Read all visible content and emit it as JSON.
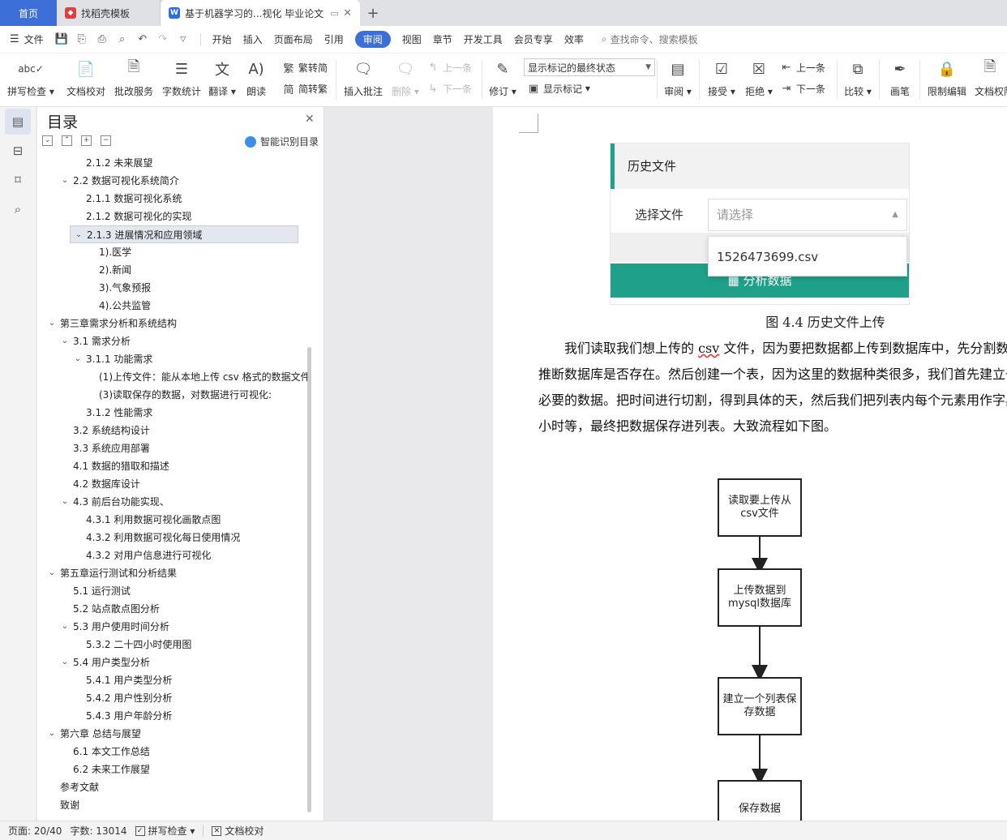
{
  "tabs": [
    {
      "label": "首页"
    },
    {
      "label": "找稻壳模板"
    },
    {
      "label": "基于机器学习的...视化 毕业论文"
    }
  ],
  "menu": {
    "file": "文件",
    "items": [
      "开始",
      "插入",
      "页面布局",
      "引用",
      "审阅",
      "视图",
      "章节",
      "开发工具",
      "会员专享",
      "效率"
    ],
    "active": "审阅",
    "search": "查找命令、搜索模板"
  },
  "ribbon": {
    "spell": "拼写检查",
    "proof": "文档校对",
    "correct": "批改服务",
    "wordcount": "字数统计",
    "translate": "翻译",
    "read": "朗读",
    "trad": "繁转简",
    "simp": "简转繁",
    "insert_comment": "插入批注",
    "delete": "删除",
    "prev": "上一条",
    "next": "下一条",
    "revise": "修订",
    "markup_state": "显示标记的最终状态",
    "show_markup": "显示标记",
    "review": "审阅",
    "accept": "接受",
    "reject": "拒绝",
    "prev2": "上一条",
    "next2": "下一条",
    "compare": "比较",
    "pen": "画笔",
    "restrict": "限制编辑",
    "doc_perm": "文档权限"
  },
  "toc": {
    "title": "目录",
    "smart": "智能识别目录",
    "items": [
      {
        "text": "2.1.2  未来展望",
        "level": 3,
        "arrow": false
      },
      {
        "text": "2.2 数据可视化系统简介",
        "level": 2,
        "arrow": true
      },
      {
        "text": "2.1.1 数据可视化系统",
        "level": 3,
        "arrow": false
      },
      {
        "text": "2.1.2  数据可视化的实现",
        "level": 3,
        "arrow": false
      },
      {
        "text": "2.1.3 进展情况和应用领域",
        "level": 3,
        "arrow": true,
        "selected": true
      },
      {
        "text": "1).医学",
        "level": 4,
        "arrow": false
      },
      {
        "text": "2).新闻",
        "level": 4,
        "arrow": false
      },
      {
        "text": "3).气象预报",
        "level": 4,
        "arrow": false
      },
      {
        "text": "4).公共监管",
        "level": 4,
        "arrow": false
      },
      {
        "text": "第三章需求分析和系统结构",
        "level": 1,
        "arrow": true
      },
      {
        "text": "3.1 需求分析",
        "level": 2,
        "arrow": true
      },
      {
        "text": "3.1.1 功能需求",
        "level": 3,
        "arrow": true
      },
      {
        "text": "(1)上传文件：能从本地上传 csv 格式的数据文件",
        "level": 4,
        "arrow": false
      },
      {
        "text": "(3)读取保存的数据，对数据进行可视化:",
        "level": 4,
        "arrow": false
      },
      {
        "text": "3.1.2 性能需求",
        "level": 3,
        "arrow": false
      },
      {
        "text": "3.2 系统结构设计",
        "level": 2,
        "arrow": false
      },
      {
        "text": "3.3 系统应用部署",
        "level": 2,
        "arrow": false
      },
      {
        "text": "4.1 数据的猎取和描述",
        "level": 2,
        "arrow": false
      },
      {
        "text": "4.2 数据库设计",
        "level": 2,
        "arrow": false
      },
      {
        "text": "4.3 前后台功能实现、",
        "level": 2,
        "arrow": true
      },
      {
        "text": "4.3.1 利用数据可视化画散点图",
        "level": 3,
        "arrow": false
      },
      {
        "text": "4.3.2 利用数据可视化每日使用情况",
        "level": 3,
        "arrow": false
      },
      {
        "text": "4.3.2  对用户信息进行可视化",
        "level": 3,
        "arrow": false
      },
      {
        "text": "第五章运行测试和分析结果",
        "level": 1,
        "arrow": true
      },
      {
        "text": "5.1  运行测试",
        "level": 2,
        "arrow": false
      },
      {
        "text": "5.2  站点散点图分析",
        "level": 2,
        "arrow": false
      },
      {
        "text": "5.3 用户使用时间分析",
        "level": 2,
        "arrow": true
      },
      {
        "text": "5.3.2 二十四小时使用图",
        "level": 3,
        "arrow": false
      },
      {
        "text": "5.4  用户类型分析",
        "level": 2,
        "arrow": true
      },
      {
        "text": "5.4.1 用户类型分析",
        "level": 3,
        "arrow": false
      },
      {
        "text": "5.4.2  用户性别分析",
        "level": 3,
        "arrow": false
      },
      {
        "text": "5.4.3 用户年龄分析",
        "level": 3,
        "arrow": false
      },
      {
        "text": "第六章  总结与展望",
        "level": 1,
        "arrow": true
      },
      {
        "text": "6.1  本文工作总结",
        "level": 2,
        "arrow": false
      },
      {
        "text": "6.2 未来工作展望",
        "level": 2,
        "arrow": false
      },
      {
        "text": "参考文献",
        "level": 1,
        "arrow": false
      },
      {
        "text": "致谢",
        "level": 1,
        "arrow": false
      }
    ]
  },
  "document": {
    "figure": {
      "header": "历史文件",
      "label": "选择文件",
      "placeholder": "请选择",
      "option": "1526473699.csv",
      "button": "分析数据"
    },
    "caption": "图 4.4  历史文件上传",
    "paragraph": [
      "我们读取我们想上传的 ",
      "csv",
      " 文件，因为要把数据都上传到数据库中，先分割数据名，",
      "推断数据库是否存在。然后创建一个表，因为这里的数据种类很多，我们首先建立一个",
      "必要的数据。把时间进行切割，得到具体的天，然后我们把列表内每个元素用作字典",
      "小时等，最终把数据保存进列表。大致流程如下图。"
    ],
    "flow": [
      "读取要上传从csv文件",
      "上传数据到mysql数据库",
      "建立一个列表保存数据",
      "保存数据"
    ]
  },
  "status": {
    "page": "页面: 20/40",
    "words": "字数: 13014",
    "spell": "拼写检查",
    "proof": "文档校对"
  },
  "colors": {
    "accent": "#3c6fd8",
    "teal": "#1fa08b"
  }
}
